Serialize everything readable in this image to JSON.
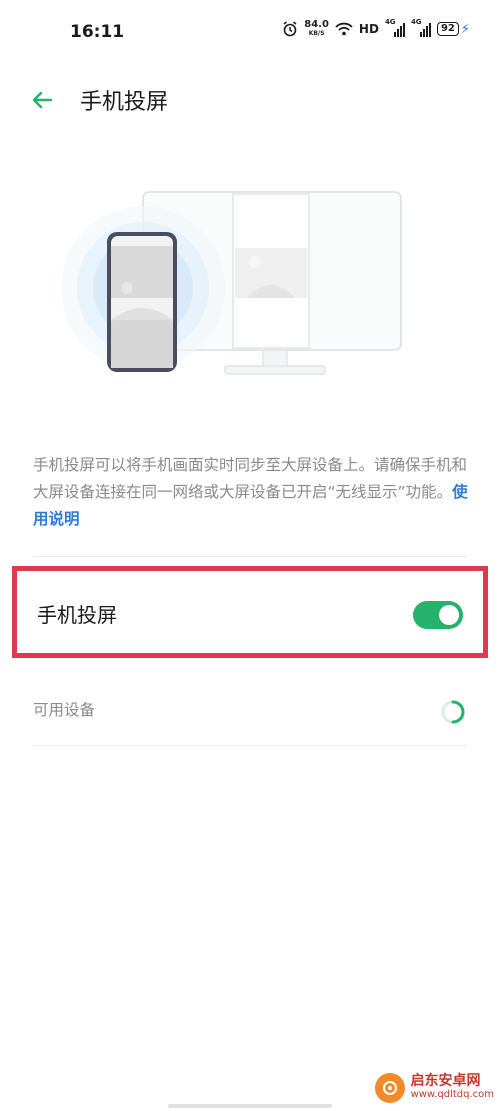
{
  "status_bar": {
    "time": "16:11",
    "net_speed_value": "84.0",
    "net_speed_unit": "KB/S",
    "hd_label": "HD",
    "signal1_label": "4G",
    "signal2_label": "4G",
    "battery_level": "92",
    "icons": [
      "alarm-icon",
      "wifi-icon",
      "signal-icon",
      "battery-icon",
      "charging-icon"
    ]
  },
  "app_bar": {
    "title": "手机投屏",
    "back_icon": "arrow-left-icon"
  },
  "description": {
    "text": "手机投屏可以将手机画面实时同步至大屏设备上。请确保手机和大屏设备连接在同一网络或大屏设备已开启“无线显示”功能。",
    "link_text": "使用说明"
  },
  "cast_toggle": {
    "label": "手机投屏",
    "enabled": true
  },
  "available_devices": {
    "label": "可用设备",
    "status": "searching"
  },
  "watermark": {
    "name": "启东安卓网",
    "url": "www.qdltdq.com"
  },
  "colors": {
    "accent": "#25b26a",
    "link": "#2e7bd6",
    "highlight_border": "#e03850",
    "secondary_text": "#8a8a8a"
  }
}
